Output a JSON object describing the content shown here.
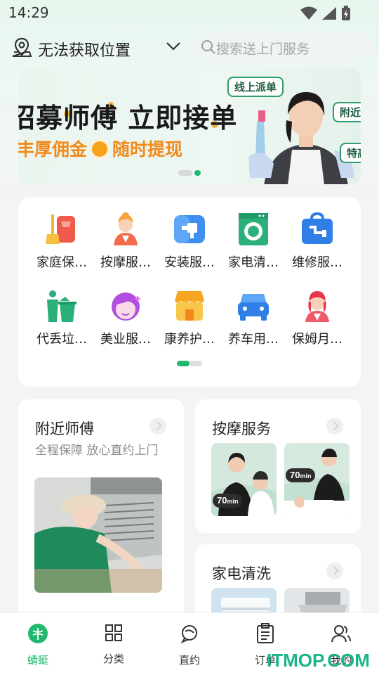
{
  "status": {
    "time": "14:29"
  },
  "location": {
    "label": "无法获取位置"
  },
  "search": {
    "placeholder": "搜索送上门服务"
  },
  "banner": {
    "title": "招募师傅 立即接单",
    "subtitle_left": "丰厚佣金",
    "subtitle_right": "随时提现",
    "tags": [
      "线上派单",
      "附近",
      "特高"
    ],
    "dots": 2,
    "active_dot": 1
  },
  "categories": [
    {
      "label": "家庭保…",
      "icon": "broom-icon"
    },
    {
      "label": "按摩服…",
      "icon": "masseuse-icon"
    },
    {
      "label": "安装服…",
      "icon": "drill-icon"
    },
    {
      "label": "家电清…",
      "icon": "washing-machine-icon"
    },
    {
      "label": "维修服…",
      "icon": "toolbox-icon"
    },
    {
      "label": "代丢垃…",
      "icon": "trash-bin-icon"
    },
    {
      "label": "美业服…",
      "icon": "beauty-face-icon"
    },
    {
      "label": "康养护…",
      "icon": "shop-icon"
    },
    {
      "label": "养车用…",
      "icon": "car-icon"
    },
    {
      "label": "保姆月…",
      "icon": "nanny-icon"
    }
  ],
  "nearby": {
    "title": "附近师傅",
    "subtitle": "全程保障 放心直约上门"
  },
  "massage": {
    "title": "按摩服务",
    "badge": "70",
    "badge_unit": "min"
  },
  "appliance": {
    "title": "家电清洗"
  },
  "tabs": [
    {
      "label": "蜻蜓",
      "icon": "dragonfly-icon",
      "active": true
    },
    {
      "label": "分类",
      "icon": "grid-icon",
      "active": false
    },
    {
      "label": "直约",
      "icon": "chat-icon",
      "active": false
    },
    {
      "label": "订单",
      "icon": "clipboard-icon",
      "active": false
    },
    {
      "label": "我的",
      "icon": "user-icon",
      "active": false
    }
  ],
  "watermark": "ITMOP.COM",
  "colors": {
    "accent": "#1fb86c",
    "orange": "#f18a1a"
  }
}
